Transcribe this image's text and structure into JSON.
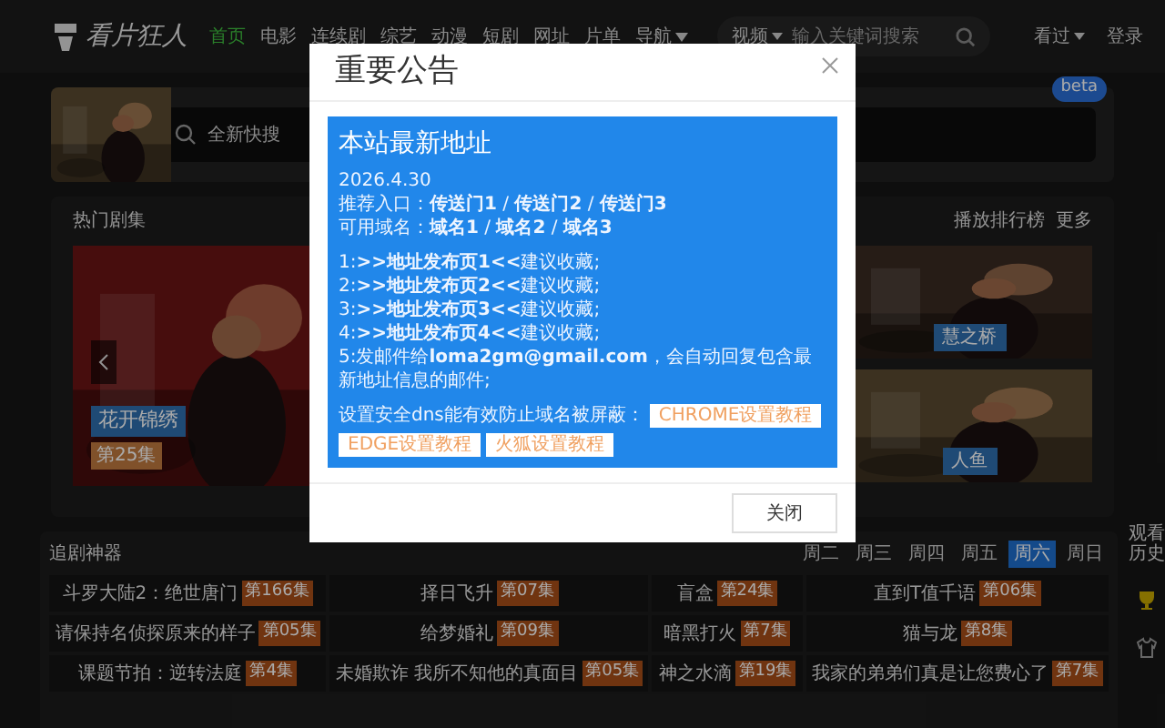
{
  "header": {
    "logo": "看片狂人",
    "nav": [
      {
        "label": "首页",
        "selected": true,
        "has_caret": false
      },
      {
        "label": "电影",
        "selected": false,
        "has_caret": false
      },
      {
        "label": "连续剧",
        "selected": false,
        "has_caret": false
      },
      {
        "label": "综艺",
        "selected": false,
        "has_caret": false
      },
      {
        "label": "动漫",
        "selected": false,
        "has_caret": false
      },
      {
        "label": "短剧",
        "selected": false,
        "has_caret": false
      },
      {
        "label": "网址",
        "selected": false,
        "has_caret": false
      },
      {
        "label": "片单",
        "selected": false,
        "has_caret": false
      },
      {
        "label": "导航",
        "selected": false,
        "has_caret": true
      }
    ],
    "search": {
      "scope": "视频",
      "placeholder": "输入关键词搜索"
    },
    "history": "看过",
    "login": "登录"
  },
  "banner": {
    "search_placeholder": "全新快搜",
    "badge": "beta"
  },
  "hot": {
    "title": "热门剧集",
    "links": [
      "播放排行榜",
      "更多"
    ],
    "featured": {
      "title": "花开锦绣",
      "episode": "第25集"
    },
    "thumbs": [
      {
        "title": "慧之桥"
      },
      {
        "title": "人鱼"
      }
    ]
  },
  "schedule": {
    "title": "追剧神器",
    "days": [
      {
        "label": "周二",
        "selected": false
      },
      {
        "label": "周三",
        "selected": false
      },
      {
        "label": "周四",
        "selected": false
      },
      {
        "label": "周五",
        "selected": false
      },
      {
        "label": "周六",
        "selected": true
      },
      {
        "label": "周日",
        "selected": false
      }
    ],
    "items": [
      {
        "name": "斗罗大陆2：绝世唐门",
        "episode": "第166集"
      },
      {
        "name": "择日飞升",
        "episode": "第07集"
      },
      {
        "name": "盲盒",
        "episode": "第24集"
      },
      {
        "name": "直到T值千语",
        "episode": "第06集"
      },
      {
        "name": "请保持名侦探原来的样子",
        "episode": "第05集"
      },
      {
        "name": "给梦婚礼",
        "episode": "第09集"
      },
      {
        "name": "暗黑打火",
        "episode": "第7集"
      },
      {
        "name": "猫与龙",
        "episode": "第8集"
      },
      {
        "name": "课题节拍：逆转法庭",
        "episode": "第4集"
      },
      {
        "name": "未婚欺诈 我所不知他的真面目",
        "episode": "第05集"
      },
      {
        "name": "神之水滴",
        "episode": "第19集"
      },
      {
        "name": "我家的弟弟们真是让您费心了",
        "episode": "第7集"
      }
    ]
  },
  "sidebar": {
    "history": "观看历史"
  },
  "modal": {
    "title": "重要公告",
    "heading": "本站最新地址",
    "date": "2026.4.30",
    "lines": [
      "推荐入口：**传送门1** / **传送门2** / **传送门3**",
      "可用域名：**域名1** / **域名2** / **域名3**"
    ],
    "items": [
      "1:**>>地址发布页1<<**建议收藏;",
      "2:**>>地址发布页2<<**建议收藏;",
      "3:**>>地址发布页3<<**建议收藏;",
      "4:**>>地址发布页4<<**建议收藏;",
      "5:发邮件给**loma2gm@gmail.com**，会自动回复包含最新地址信息的邮件;"
    ],
    "dns_text": "设置安全dns能有效防止域名被屏蔽：",
    "guides": [
      "CHROME设置教程",
      "EDGE设置教程",
      "火狐设置教程"
    ],
    "close_button": "关闭"
  }
}
